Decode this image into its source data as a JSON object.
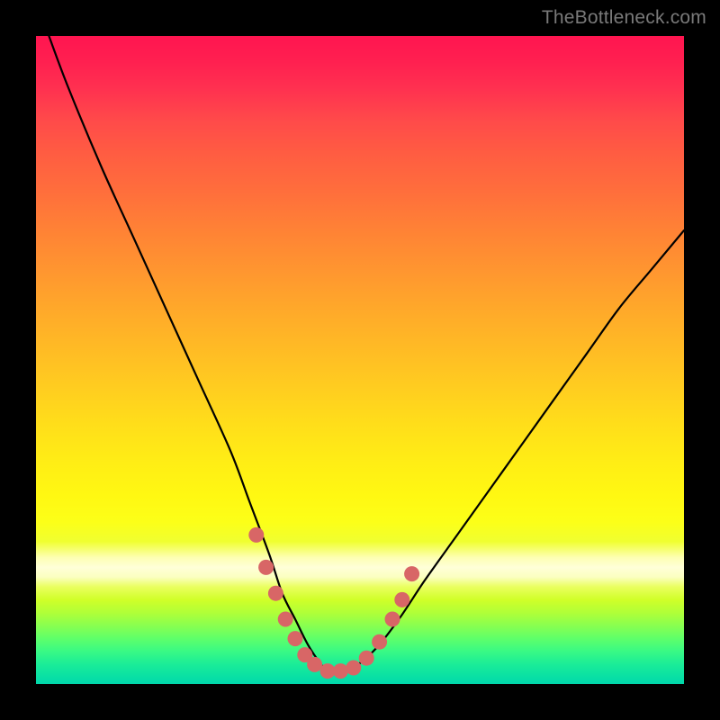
{
  "watermark": "TheBottleneck.com",
  "chart_data": {
    "type": "line",
    "title": "",
    "xlabel": "",
    "ylabel": "",
    "xlim": [
      0,
      100
    ],
    "ylim": [
      0,
      100
    ],
    "series": [
      {
        "name": "bottleneck-curve",
        "x": [
          2,
          5,
          10,
          15,
          20,
          25,
          30,
          33,
          36,
          38,
          40,
          42,
          44,
          45,
          48,
          52,
          56,
          60,
          65,
          70,
          75,
          80,
          85,
          90,
          95,
          100
        ],
        "y": [
          100,
          92,
          80,
          69,
          58,
          47,
          36,
          28,
          20,
          14,
          10,
          6,
          3,
          2,
          2,
          5,
          10,
          16,
          23,
          30,
          37,
          44,
          51,
          58,
          64,
          70
        ]
      }
    ],
    "markers": {
      "name": "highlight-dots",
      "color": "#d86666",
      "points": [
        {
          "x": 34,
          "y": 23
        },
        {
          "x": 35.5,
          "y": 18
        },
        {
          "x": 37,
          "y": 14
        },
        {
          "x": 38.5,
          "y": 10
        },
        {
          "x": 40,
          "y": 7
        },
        {
          "x": 41.5,
          "y": 4.5
        },
        {
          "x": 43,
          "y": 3
        },
        {
          "x": 45,
          "y": 2
        },
        {
          "x": 47,
          "y": 2
        },
        {
          "x": 49,
          "y": 2.5
        },
        {
          "x": 51,
          "y": 4
        },
        {
          "x": 53,
          "y": 6.5
        },
        {
          "x": 55,
          "y": 10
        },
        {
          "x": 56.5,
          "y": 13
        },
        {
          "x": 58,
          "y": 17
        }
      ]
    }
  }
}
